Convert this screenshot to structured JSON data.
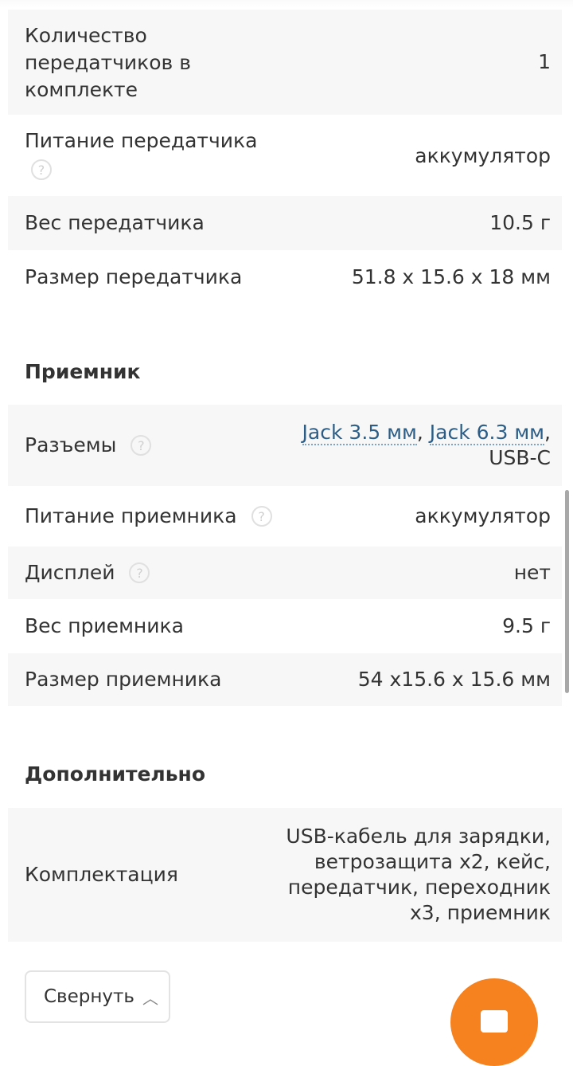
{
  "transmitter": {
    "count": {
      "label": "Количество передатчиков в комплекте",
      "value": "1"
    },
    "power": {
      "label": "Питание передатчика",
      "value": "аккумулятор"
    },
    "weight": {
      "label": "Вес передатчика",
      "value": "10.5 г"
    },
    "size": {
      "label": "Размер передатчика",
      "value": "51.8 x 15.6 x 18 мм"
    }
  },
  "receiver": {
    "title": "Приемник",
    "connectors": {
      "label": "Разъемы",
      "links": [
        "Jack 3.5 мм",
        "Jack 6.3 мм"
      ],
      "sep": ",",
      "rest": "USB-C"
    },
    "power": {
      "label": "Питание приемника",
      "value": "аккумулятор"
    },
    "display": {
      "label": "Дисплей",
      "value": "нет"
    },
    "weight": {
      "label": "Вес приемника",
      "value": "9.5 г"
    },
    "size": {
      "label": "Размер приемника",
      "value": "54 x15.6 x 15.6 мм"
    }
  },
  "extra": {
    "title": "Дополнительно",
    "kit": {
      "label": "Комплектация",
      "value": "USB-кабель для зарядки, ветрозащита x2, кейс, передатчик, переходник x3, приемник"
    }
  },
  "collapse_label": "Свернуть",
  "help_glyph": "?",
  "chevron_glyph": "︿",
  "colors": {
    "accent": "#f5811f",
    "link": "#2b5d86",
    "row_shade": "#f7f7f7"
  }
}
